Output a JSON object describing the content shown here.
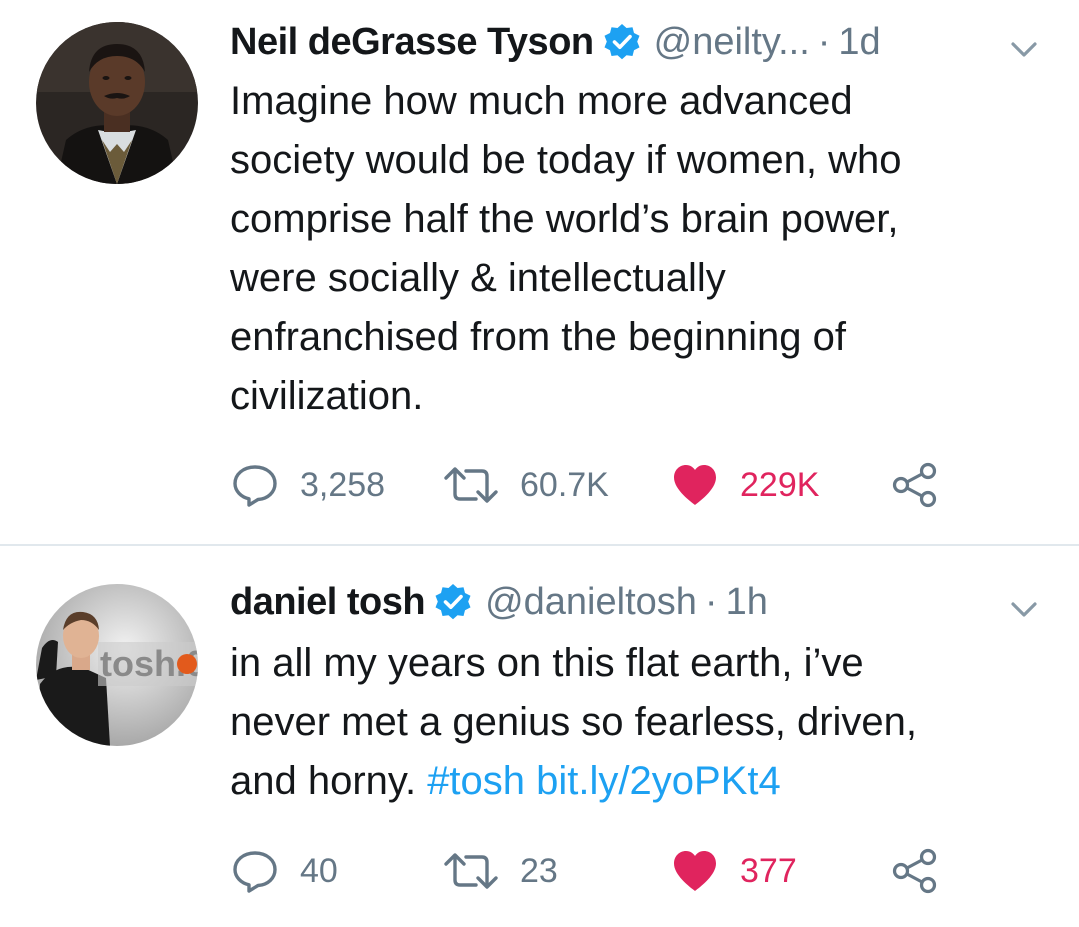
{
  "colors": {
    "text": "#14171a",
    "secondary": "#657786",
    "link": "#1da1f2",
    "like": "#e0245e",
    "verified": "#1da1f2",
    "divider": "#e1e8ed"
  },
  "tweets": [
    {
      "name": "Neil deGrasse Tyson",
      "handle": "@neilty...",
      "time": "1d",
      "avatar_icon": "avatar-neil-degrasse-tyson",
      "lines": [
        "Imagine how much more advanced",
        "society would be today if women, who",
        "comprise half the world’s brain power,",
        "were socially & intellectually",
        "enfranchised from the beginning of",
        "civilization."
      ],
      "replies": "3,258",
      "retweets": "60.7K",
      "likes": "229K",
      "liked": true
    },
    {
      "name": "daniel tosh",
      "handle": "@danieltosh",
      "time": "1h",
      "avatar_icon": "avatar-daniel-tosh",
      "avatar_logo_text": "tosh.0",
      "lines": [
        "in all my years on this flat earth, i’ve",
        "never met a genius so fearless, driven,"
      ],
      "last_line_text": "and horny.",
      "hashtag": "#tosh",
      "url": "bit.ly/2yoPKt4",
      "replies": "40",
      "retweets": "23",
      "likes": "377",
      "liked": true
    }
  ],
  "icons": {
    "verified": "verified-badge-icon",
    "menu": "chevron-down-icon",
    "reply": "reply-icon",
    "retweet": "retweet-icon",
    "like": "heart-icon",
    "share": "share-icon"
  }
}
